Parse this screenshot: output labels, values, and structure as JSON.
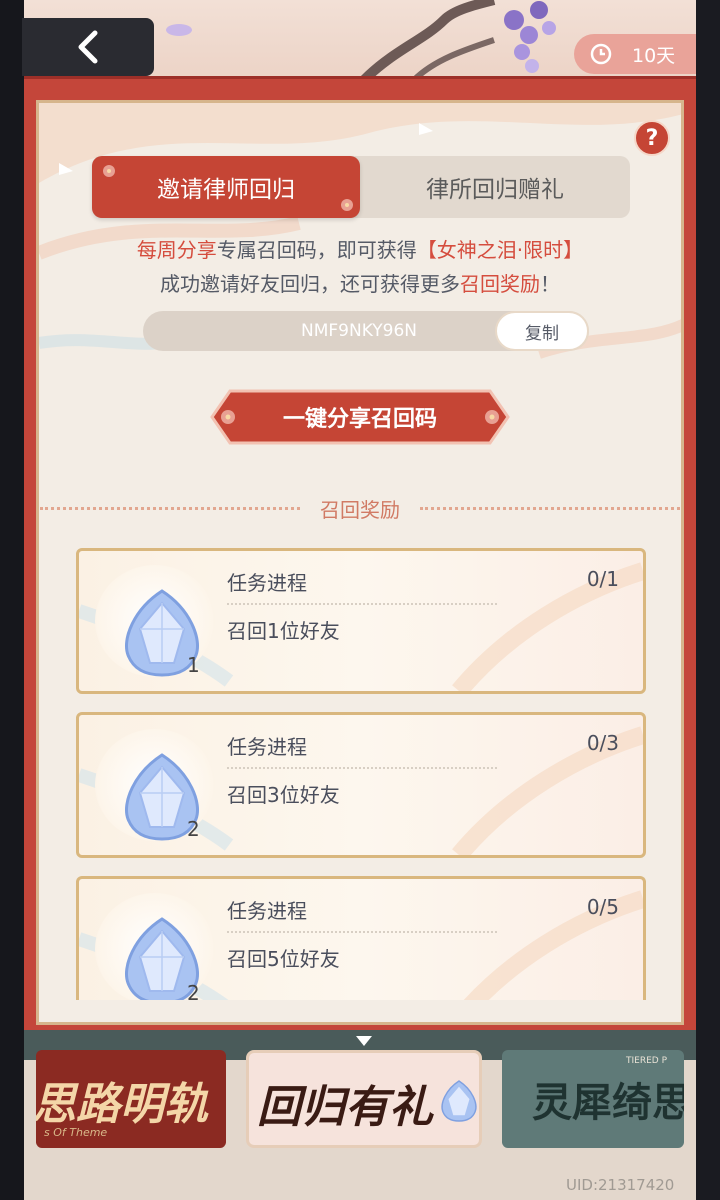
{
  "header": {
    "back_icon": "chevron-left-icon",
    "timer_icon": "clock-icon",
    "timer_text": "10天"
  },
  "help": {
    "label": "?"
  },
  "tabs": [
    {
      "label": "邀请律师回归",
      "active": true
    },
    {
      "label": "律所回归赠礼",
      "active": false
    }
  ],
  "intro": {
    "l1_a": "每周分享",
    "l1_b": "专属召回码，即可获得",
    "l1_c": "【女神之泪·限时】",
    "l2_a": "成功邀请好友回归，还可获得更多",
    "l2_b": "召回奖励",
    "l2_c": "！"
  },
  "code": {
    "value": "NMF9NKY96N",
    "copy_label": "复制"
  },
  "share_button": {
    "label": "一键分享召回码"
  },
  "rewards": {
    "section_title": "召回奖励",
    "items": [
      {
        "progress_label": "任务进程",
        "progress": "0/1",
        "desc": "召回1位好友",
        "qty": "1",
        "icon": "tear-gem-icon"
      },
      {
        "progress_label": "任务进程",
        "progress": "0/3",
        "desc": "召回3位好友",
        "qty": "2",
        "icon": "tear-gem-icon"
      },
      {
        "progress_label": "任务进程",
        "progress": "0/5",
        "desc": "召回5位好友",
        "qty": "2",
        "icon": "tear-gem-icon"
      }
    ]
  },
  "banners": [
    {
      "title": "思路明轨",
      "sub": "s Of Theme"
    },
    {
      "title": "回归有礼"
    },
    {
      "title": "灵犀绮思",
      "sub": "TIERED P"
    }
  ],
  "uid": "UID:21317420",
  "colors": {
    "accent_red": "#c54535",
    "highlight_red": "#d54d3e",
    "gold": "#d9b77e",
    "panel_bg": "#f3ede5"
  }
}
